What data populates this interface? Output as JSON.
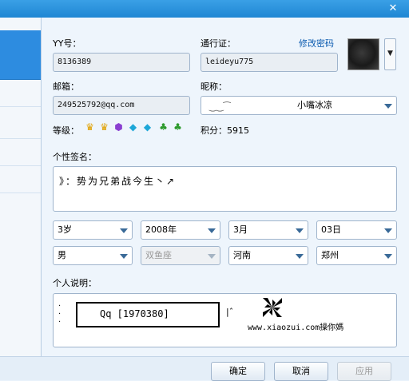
{
  "window": {
    "close_glyph": "✕"
  },
  "profile": {
    "yy_label": "YY号：",
    "yy_value": "8136389",
    "passport_label": "通行证：",
    "passport_value": "leideyu775",
    "change_password_link": "修改密码",
    "email_label": "邮箱：",
    "email_value": "249525792@qq.com",
    "nickname_label": "昵称：",
    "nickname_value": "小嘴冰凉",
    "level_label": "等级：",
    "level_badges": [
      "crown-icon",
      "crown-icon",
      "gem-purple-icon",
      "diamond-icon",
      "diamond-icon",
      "clover-icon",
      "clover-icon"
    ],
    "points_label": "积分：5915",
    "signature_label": "个性签名：",
    "signature_text": "》：势为兄弟战今生丶↗",
    "age": "3岁",
    "year": "2008年",
    "month": "3月",
    "day": "03日",
    "gender": "男",
    "zodiac": "双鱼座",
    "province": "河南",
    "city": "郑州",
    "description_label": "个人说明：",
    "description_box_text": "Qq [1970380]",
    "description_extra": "|ˆ",
    "description_url": "www.xiaozui.com操你媽"
  },
  "footer": {
    "ok_label": "确定",
    "cancel_label": "取消",
    "apply_label": "应用"
  },
  "colors": {
    "titlebar": "#2d8ce0",
    "sidebar_selected": "#2d8ce0",
    "link": "#0b5bb0"
  }
}
